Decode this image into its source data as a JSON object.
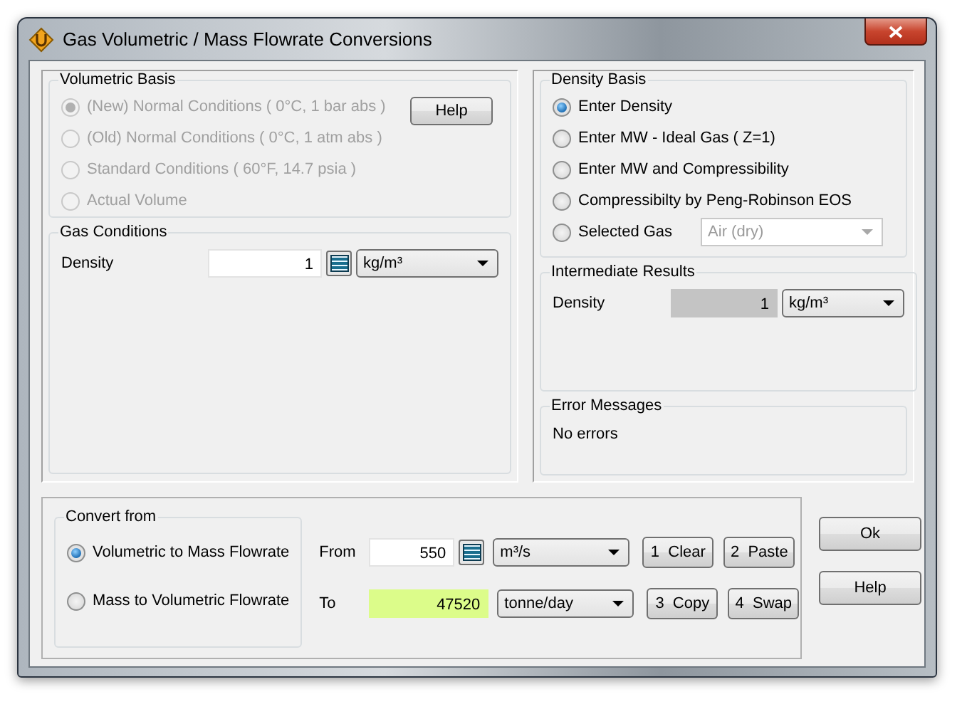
{
  "window": {
    "title": "Gas Volumetric / Mass Flowrate Conversions"
  },
  "volumetric_basis": {
    "title": "Volumetric Basis",
    "help_button": "Help",
    "options": [
      {
        "label": "(New) Normal Conditions ( 0°C,  1 bar abs )",
        "selected": true,
        "disabled": true
      },
      {
        "label": "(Old) Normal Conditions ( 0°C,  1 atm abs )",
        "selected": false,
        "disabled": true
      },
      {
        "label": "Standard Conditions ( 60°F, 14.7 psia )",
        "selected": false,
        "disabled": true
      },
      {
        "label": "Actual Volume",
        "selected": false,
        "disabled": true
      }
    ]
  },
  "gas_conditions": {
    "title": "Gas Conditions",
    "label": "Density",
    "value": "1",
    "unit": "kg/m³"
  },
  "density_basis": {
    "title": "Density Basis",
    "options": [
      {
        "label": "Enter Density",
        "selected": true,
        "disabled": false
      },
      {
        "label": "Enter MW - Ideal Gas ( Z=1)",
        "selected": false,
        "disabled": false
      },
      {
        "label": "Enter MW and Compressibility",
        "selected": false,
        "disabled": false
      },
      {
        "label": "Compressibilty by Peng-Robinson EOS",
        "selected": false,
        "disabled": false
      },
      {
        "label": "Selected Gas",
        "selected": false,
        "disabled": false
      }
    ],
    "selected_gas": {
      "value": "Air (dry)",
      "disabled": true
    }
  },
  "intermediate_results": {
    "title": "Intermediate Results",
    "label": "Density",
    "value": "1",
    "unit": "kg/m³"
  },
  "error_messages": {
    "title": "Error Messages",
    "text": "No errors"
  },
  "convert_from": {
    "title": "Convert from",
    "options": [
      {
        "label": "Volumetric to Mass Flowrate",
        "selected": true,
        "disabled": false
      },
      {
        "label": "Mass to Volumetric Flowrate",
        "selected": false,
        "disabled": false
      }
    ]
  },
  "from": {
    "label": "From",
    "value": "550",
    "unit": "m³/s"
  },
  "to": {
    "label": "To",
    "value": "47520",
    "unit": "tonne/day"
  },
  "action_buttons": [
    "1  Clear",
    "2  Paste",
    "3  Copy",
    "4  Swap"
  ],
  "dialog_buttons": [
    "Ok",
    "Help"
  ]
}
